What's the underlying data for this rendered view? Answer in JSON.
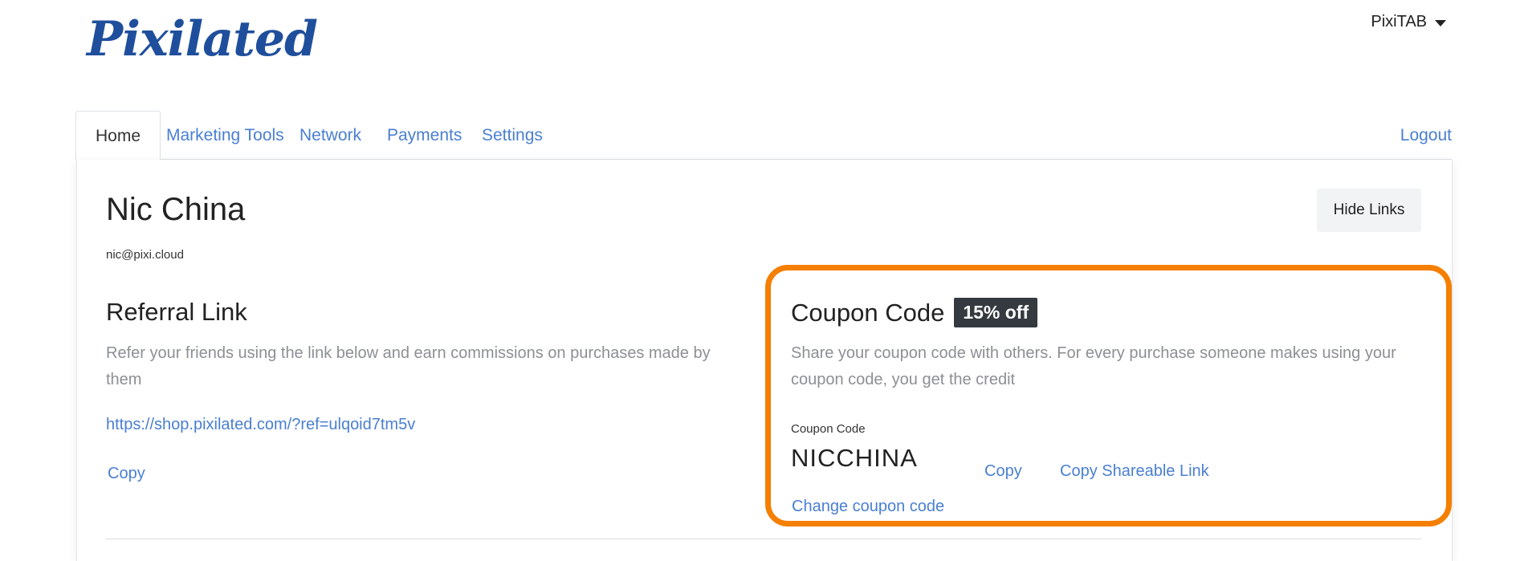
{
  "brand": {
    "logo_text": "Pixilated"
  },
  "user_menu": {
    "label": "PixiTAB",
    "icon": "caret-down-icon"
  },
  "tabs": [
    {
      "label": "Home",
      "active": true
    },
    {
      "label": "Marketing Tools",
      "active": false
    },
    {
      "label": "Network",
      "active": false
    },
    {
      "label": "Payments",
      "active": false
    },
    {
      "label": "Settings",
      "active": false
    }
  ],
  "logout_label": "Logout",
  "profile": {
    "name": "Nic China",
    "email": "nic@pixi.cloud",
    "hide_links_label": "Hide Links"
  },
  "referral": {
    "title": "Referral Link",
    "description": "Refer your friends using the link below and earn commissions on purchases made by them",
    "link": "https://shop.pixilated.com/?ref=ulqoid7tm5v",
    "copy_label": "Copy"
  },
  "coupon": {
    "title": "Coupon Code",
    "badge": "15% off",
    "description": "Share your coupon code with others. For every purchase someone makes using your coupon code, you get the credit",
    "field_label": "Coupon Code",
    "code": "NICCHINA",
    "copy_label": "Copy",
    "share_label": "Copy Shareable Link",
    "change_label": "Change coupon code"
  },
  "colors": {
    "link": "#4a7fd1",
    "brand": "#1f4f9c",
    "highlight_border": "#f47f00",
    "badge_bg": "#343a40"
  }
}
